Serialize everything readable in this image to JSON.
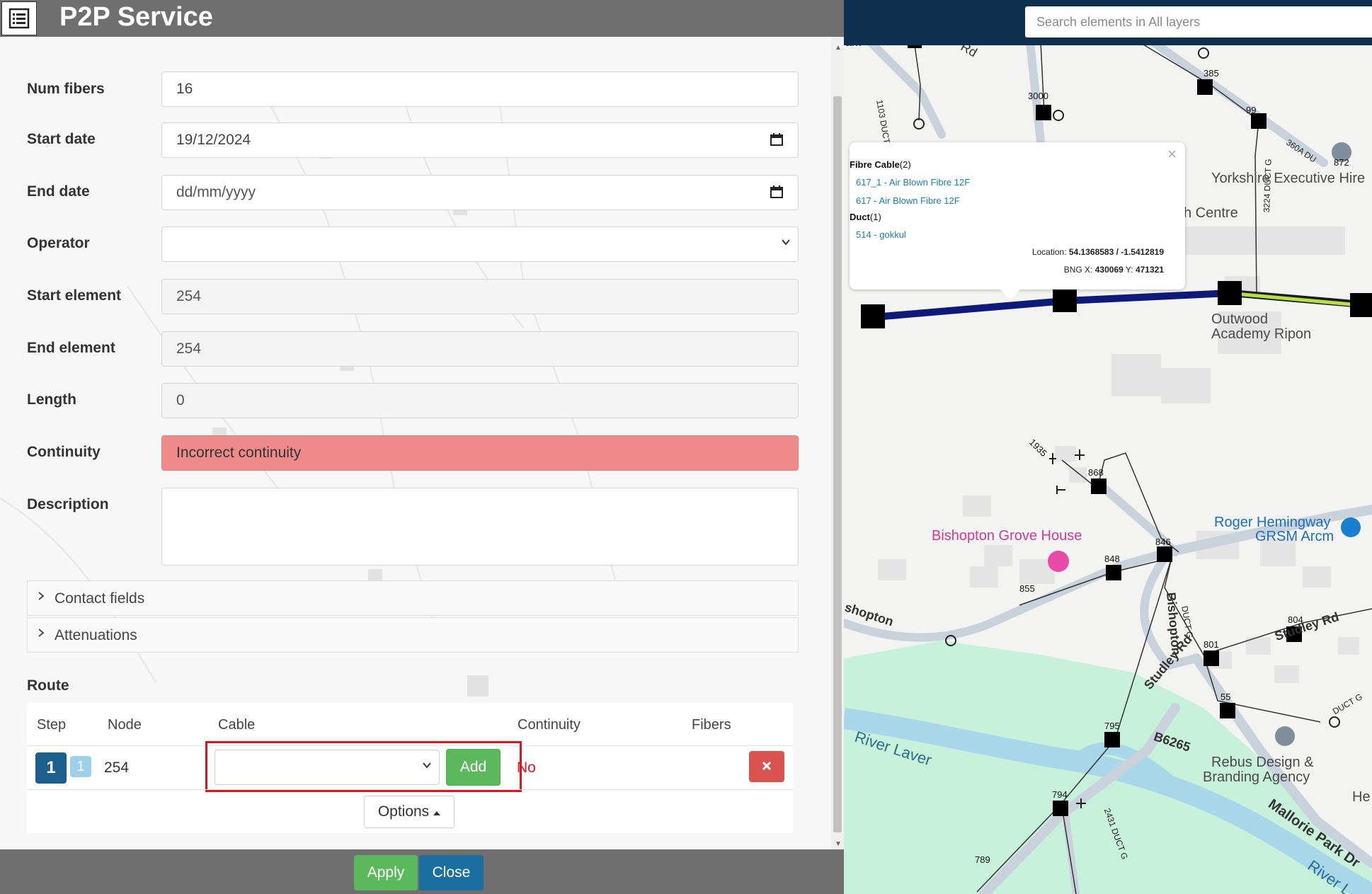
{
  "dialog": {
    "title": "P2P Service"
  },
  "form": {
    "num_fibers": {
      "label": "Num fibers",
      "value": "16"
    },
    "start_date": {
      "label": "Start date",
      "value": "19/12/2024"
    },
    "end_date": {
      "label": "End date",
      "placeholder": "dd/mm/yyyy"
    },
    "operator": {
      "label": "Operator",
      "value": ""
    },
    "start_element": {
      "label": "Start element",
      "value": "254"
    },
    "end_element": {
      "label": "End element",
      "value": "254"
    },
    "length": {
      "label": "Length",
      "value": "0"
    },
    "continuity": {
      "label": "Continuity",
      "value": "Incorrect continuity",
      "color": "#ef8a8a"
    },
    "description": {
      "label": "Description",
      "value": ""
    }
  },
  "accordions": [
    {
      "label": "Contact fields"
    },
    {
      "label": "Attenuations"
    }
  ],
  "route": {
    "title": "Route",
    "columns": [
      "Step",
      "Node",
      "Cable",
      "Continuity",
      "Fibers"
    ],
    "row": {
      "step": "1",
      "step_sub": "1",
      "node": "254",
      "cable": "",
      "add_label": "Add",
      "continuity": "No",
      "delete_icon": "times-icon"
    },
    "options_label": "Options"
  },
  "footer": {
    "apply_label": "Apply",
    "close_label": "Close"
  },
  "map": {
    "search_placeholder": "Search elements in All layers",
    "popup": {
      "groups": [
        {
          "name": "Fibre Cable",
          "count": "(2)",
          "items": [
            "617_1 - Air Blown Fibre 12F",
            "617 - Air Blown Fibre 12F"
          ]
        },
        {
          "name": "Duct",
          "count": "(1)",
          "items": [
            "514 - gokkul"
          ]
        }
      ],
      "location_label": "Location:",
      "location_value": "54.1368583 / -1.5412819",
      "bng_label": "BNG X:",
      "bng_x": "430069",
      "bng_y_label": "Y:",
      "bng_y": "471321"
    },
    "labels": {
      "n3000": "3000",
      "n385": "385",
      "n99": "99",
      "n872": "872",
      "n868": "868",
      "n846": "846",
      "n848": "848",
      "n855": "855",
      "n804": "804",
      "n801": "801",
      "n55": "55",
      "n795": "795",
      "n794": "794",
      "n789": "789",
      "n1935": "1935",
      "duct1103": "1103 DUCT G",
      "duct3224": "3224 DUCT G",
      "duct360a": "360A DU",
      "duct2431": "2431 DUCT G",
      "ductg": "DUCT G",
      "ductg2": "DUCT G",
      "rd_top": "Rd",
      "ark": "ark",
      "yorkshire": "Yorkshire Executive Hire",
      "centre": "h Centre",
      "outwood1": "Outwood",
      "outwood2": "Academy Ripon",
      "bishopton_grove": "Bishopton Grove House",
      "roger1": "Roger Hemingway",
      "roger2": "GRSM Arcm",
      "bishopton_road": "Bishopton",
      "shopton": "shopton",
      "studley1": "Studley Rd",
      "studley2": "Studley Rd",
      "river": "River Laver",
      "b6265": "B6265",
      "rebus1": "Rebus Design &",
      "rebus2": "Branding Agency",
      "mallorie": "Mallorie Park Dr",
      "he": "He",
      "river2": "River L"
    }
  }
}
